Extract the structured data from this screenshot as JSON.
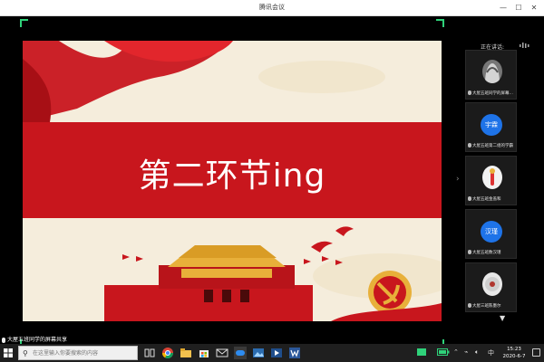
{
  "window": {
    "title": "腾讯会议",
    "minimize_label": "—",
    "maximize_label": "☐",
    "close_label": "✕"
  },
  "slide": {
    "title": "第二环节ing"
  },
  "side_panel": {
    "speaking_label": "正在讲话:",
    "participants": [
      {
        "name": "大屋五班同学的屏幕…",
        "type": "photo"
      },
      {
        "name": "大屋五班第二组的学霸",
        "type": "initials",
        "initials": "宇霖"
      },
      {
        "name": "大屋五班金盖和",
        "type": "photo"
      },
      {
        "name": "大屋五班数汉瑾",
        "type": "initials",
        "initials": "汉瑾"
      },
      {
        "name": "大屋三班陈墨尔",
        "type": "photo"
      }
    ]
  },
  "status": {
    "text": "大屋五班同学的屏幕共享"
  },
  "taskbar": {
    "search_placeholder": "在这里输入你要搜索的内容",
    "apps": [
      "task-view",
      "chrome",
      "file-explorer",
      "store",
      "mail",
      "tencent-meeting",
      "photos",
      "media",
      "word"
    ],
    "clock_time": "15:23",
    "clock_date": "2020-6-7",
    "ime_label": "中"
  },
  "colors": {
    "accent_green": "#2fd27a",
    "slide_red": "#c8161d",
    "avatar_blue": "#1e73e8"
  }
}
